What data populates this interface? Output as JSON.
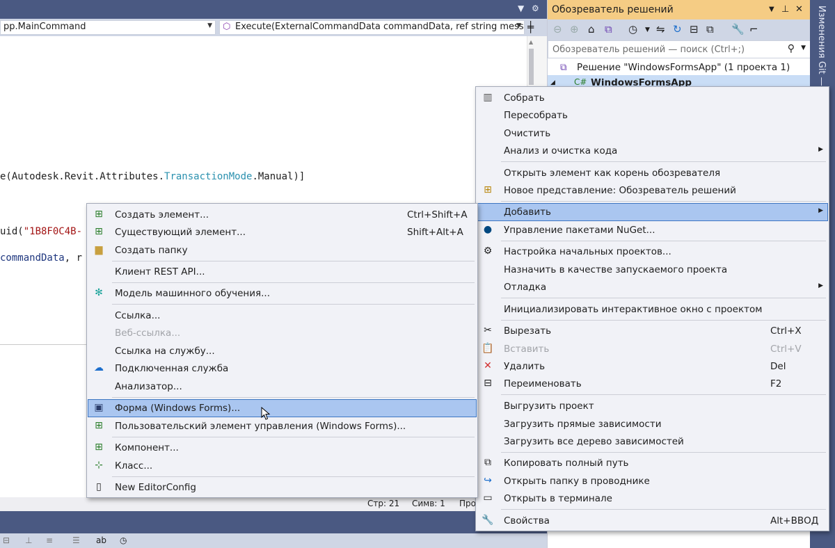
{
  "editor": {
    "class_combo": "pp.MainCommand",
    "member_combo": "Execute(ExternalCommandData commandData, ref string messag",
    "line_attr_pre": "e(Autodesk.Revit.Attributes.",
    "line_attr_type": "TransactionMode",
    "line_attr_post": ".Manual)]",
    "line_guid_pre": "uid(",
    "line_guid_str": "\"1B8F0C4B-",
    "line_param": "commandData",
    "line_param_post": ", r",
    "status": {
      "line": "Стр: 21",
      "col": "Симв: 1",
      "extra": "Про"
    }
  },
  "solution_explorer": {
    "title": "Обозреватель решений",
    "search_placeholder": "Обозреватель решений — поиск (Ctrl+;)",
    "solution_label": "Решение \"WindowsFormsApp\" (1 проекта 1)",
    "project_label": "WindowsFormsApp",
    "side_tab": "Изменения Git — Т"
  },
  "project_menu": {
    "items": [
      {
        "label": "Собрать",
        "icon": "build-icon"
      },
      {
        "label": "Пересобрать"
      },
      {
        "label": "Очистить"
      },
      {
        "label": "Анализ и очистка кода",
        "submenu": true
      },
      {
        "label": "Открыть элемент как корень обозревателя"
      },
      {
        "label": "Новое представление: Обозреватель решений",
        "icon": "new-view-icon"
      },
      {
        "label": "Добавить",
        "submenu": true
      },
      {
        "label": "Управление пакетами NuGet...",
        "icon": "nuget-icon"
      },
      {
        "label": "Настройка начальных проектов...",
        "icon": "gear-icon"
      },
      {
        "label": "Назначить в качестве запускаемого проекта"
      },
      {
        "label": "Отладка",
        "submenu": true
      },
      {
        "label": "Инициализировать интерактивное окно с проектом"
      },
      {
        "label": "Вырезать",
        "shortcut": "Ctrl+X",
        "icon": "cut-icon"
      },
      {
        "label": "Вставить",
        "shortcut": "Ctrl+V",
        "icon": "paste-icon",
        "disabled": true
      },
      {
        "label": "Удалить",
        "shortcut": "Del",
        "icon": "delete-icon"
      },
      {
        "label": "Переименовать",
        "shortcut": "F2",
        "icon": "rename-icon"
      },
      {
        "label": "Выгрузить проект"
      },
      {
        "label": "Загрузить прямые зависимости"
      },
      {
        "label": "Загрузить все дерево зависимостей"
      },
      {
        "label": "Копировать полный путь",
        "icon": "copy-icon"
      },
      {
        "label": "Открыть папку в проводнике",
        "icon": "folder-open-icon"
      },
      {
        "label": "Открыть в терминале",
        "icon": "terminal-icon"
      },
      {
        "label": "Свойства",
        "shortcut": "Alt+ВВОД",
        "icon": "wrench-icon"
      }
    ]
  },
  "add_menu": {
    "items": [
      {
        "label": "Создать элемент...",
        "shortcut": "Ctrl+Shift+A",
        "icon": "new-item-icon"
      },
      {
        "label": "Существующий элемент...",
        "shortcut": "Shift+Alt+A",
        "icon": "existing-item-icon"
      },
      {
        "label": "Создать папку",
        "icon": "new-folder-icon"
      },
      {
        "label": "Клиент REST API..."
      },
      {
        "label": "Модель машинного обучения...",
        "icon": "ml-model-icon"
      },
      {
        "label": "Ссылка..."
      },
      {
        "label": "Веб-ссылка...",
        "disabled": true
      },
      {
        "label": "Ссылка на службу..."
      },
      {
        "label": "Подключенная служба",
        "icon": "connected-service-icon"
      },
      {
        "label": "Анализатор..."
      },
      {
        "label": "Форма (Windows Forms)...",
        "icon": "windows-form-icon"
      },
      {
        "label": "Пользовательский элемент управления (Windows Forms)...",
        "icon": "user-control-icon"
      },
      {
        "label": "Компонент...",
        "icon": "component-icon"
      },
      {
        "label": "Класс...",
        "icon": "class-icon"
      },
      {
        "label": "New EditorConfig",
        "icon": "editorconfig-icon"
      }
    ]
  }
}
